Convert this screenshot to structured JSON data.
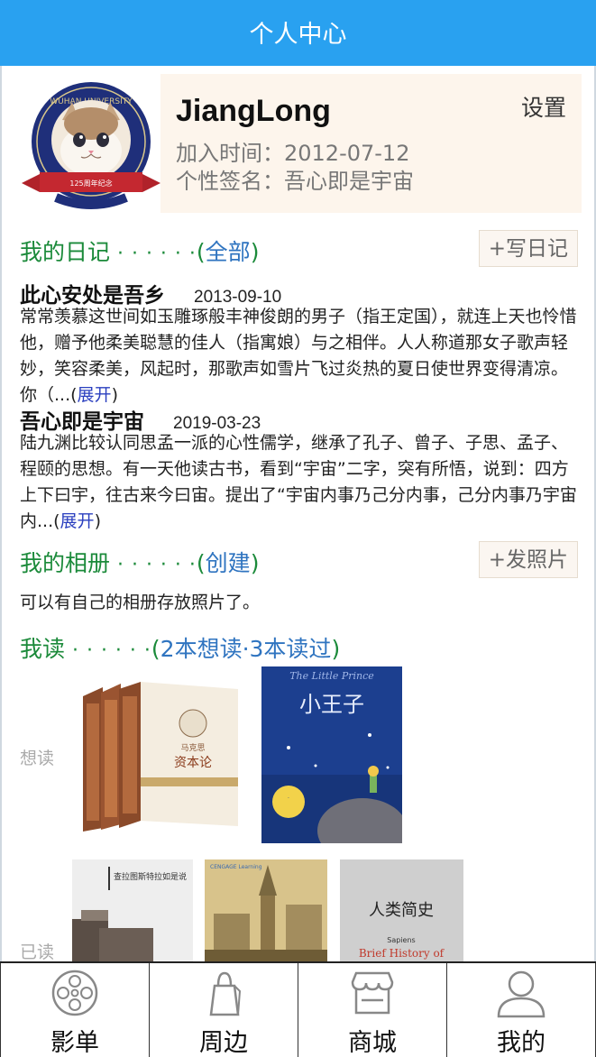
{
  "header": {
    "title": "个人中心"
  },
  "profile": {
    "username": "JiangLong",
    "join_date": "加入时间：2012-07-12",
    "signature": "个性签名：吾心即是宇宙",
    "settings_label": "设置",
    "avatar_text": "125周年纪念",
    "avatar_arc_text": "WUHAN UNIVERSITY"
  },
  "diary": {
    "title": "我的日记",
    "dots": "· · · · · ·",
    "paren_open": "(",
    "link": "全部",
    "paren_close": ")",
    "action": "+写日记",
    "entries": [
      {
        "title": "此心安处是吾乡",
        "date": "2013-09-10",
        "body": "常常羡慕这世间如玉雕琢般丰神俊朗的男子（指王定国），就连上天也怜惜他，赠予他柔美聪慧的佳人（指寓娘）与之相伴。人人称道那女子歌声轻妙，笑容柔美，风起时，那歌声如雪片飞过炎热的夏日使世界变得清凉。你（...(",
        "more": "展开",
        "close": ")"
      },
      {
        "title": "吾心即是宇宙",
        "date": "2019-03-23",
        "body": "陆九渊比较认同思孟一派的心性儒学，继承了孔子、曾子、子思、孟子、程颐的思想。有一天他读古书，看到“宇宙”二字，突有所悟，说到：四方上下曰宇，往古来今曰宙。提出了“宇宙内事乃己分内事，己分内事乃宇宙内...(",
        "more": "展开",
        "close": ")"
      }
    ]
  },
  "album": {
    "title": "我的相册",
    "dots": "· · · · · ·",
    "paren_open": "(",
    "link": "创建",
    "paren_close": ")",
    "action": "+发照片",
    "note": "可以有自己的相册存放照片了。"
  },
  "reading": {
    "title": "我读",
    "dots": "· · · · · ·",
    "paren_open": "(",
    "link": "2本想读·3本读过",
    "paren_close": ")",
    "want_label": "想读",
    "read_label": "已读",
    "want_books": [
      {
        "cover_title": "资本论",
        "cover_author": "马克思"
      },
      {
        "cover_title": "小王子",
        "cover_en": "The Little Prince"
      }
    ],
    "read_books": [
      {
        "cover_title": "查拉图斯特拉如是说"
      },
      {
        "cover_brand": "CENGAGE Learning"
      },
      {
        "cover_title": "人类简史",
        "cover_en": "Sapiens",
        "cover_en2": "Brief History of"
      }
    ]
  },
  "tabbar": {
    "items": [
      {
        "label": "影单",
        "icon": "film-reel-icon"
      },
      {
        "label": "周边",
        "icon": "shopping-bag-icon"
      },
      {
        "label": "商城",
        "icon": "store-icon"
      },
      {
        "label": "我的",
        "icon": "user-icon"
      }
    ]
  },
  "colors": {
    "header": "#29a1f0",
    "section": "#1b8a3a",
    "link": "#2f74c0",
    "more": "#2a3fbf",
    "card": "#fdf5ec"
  }
}
